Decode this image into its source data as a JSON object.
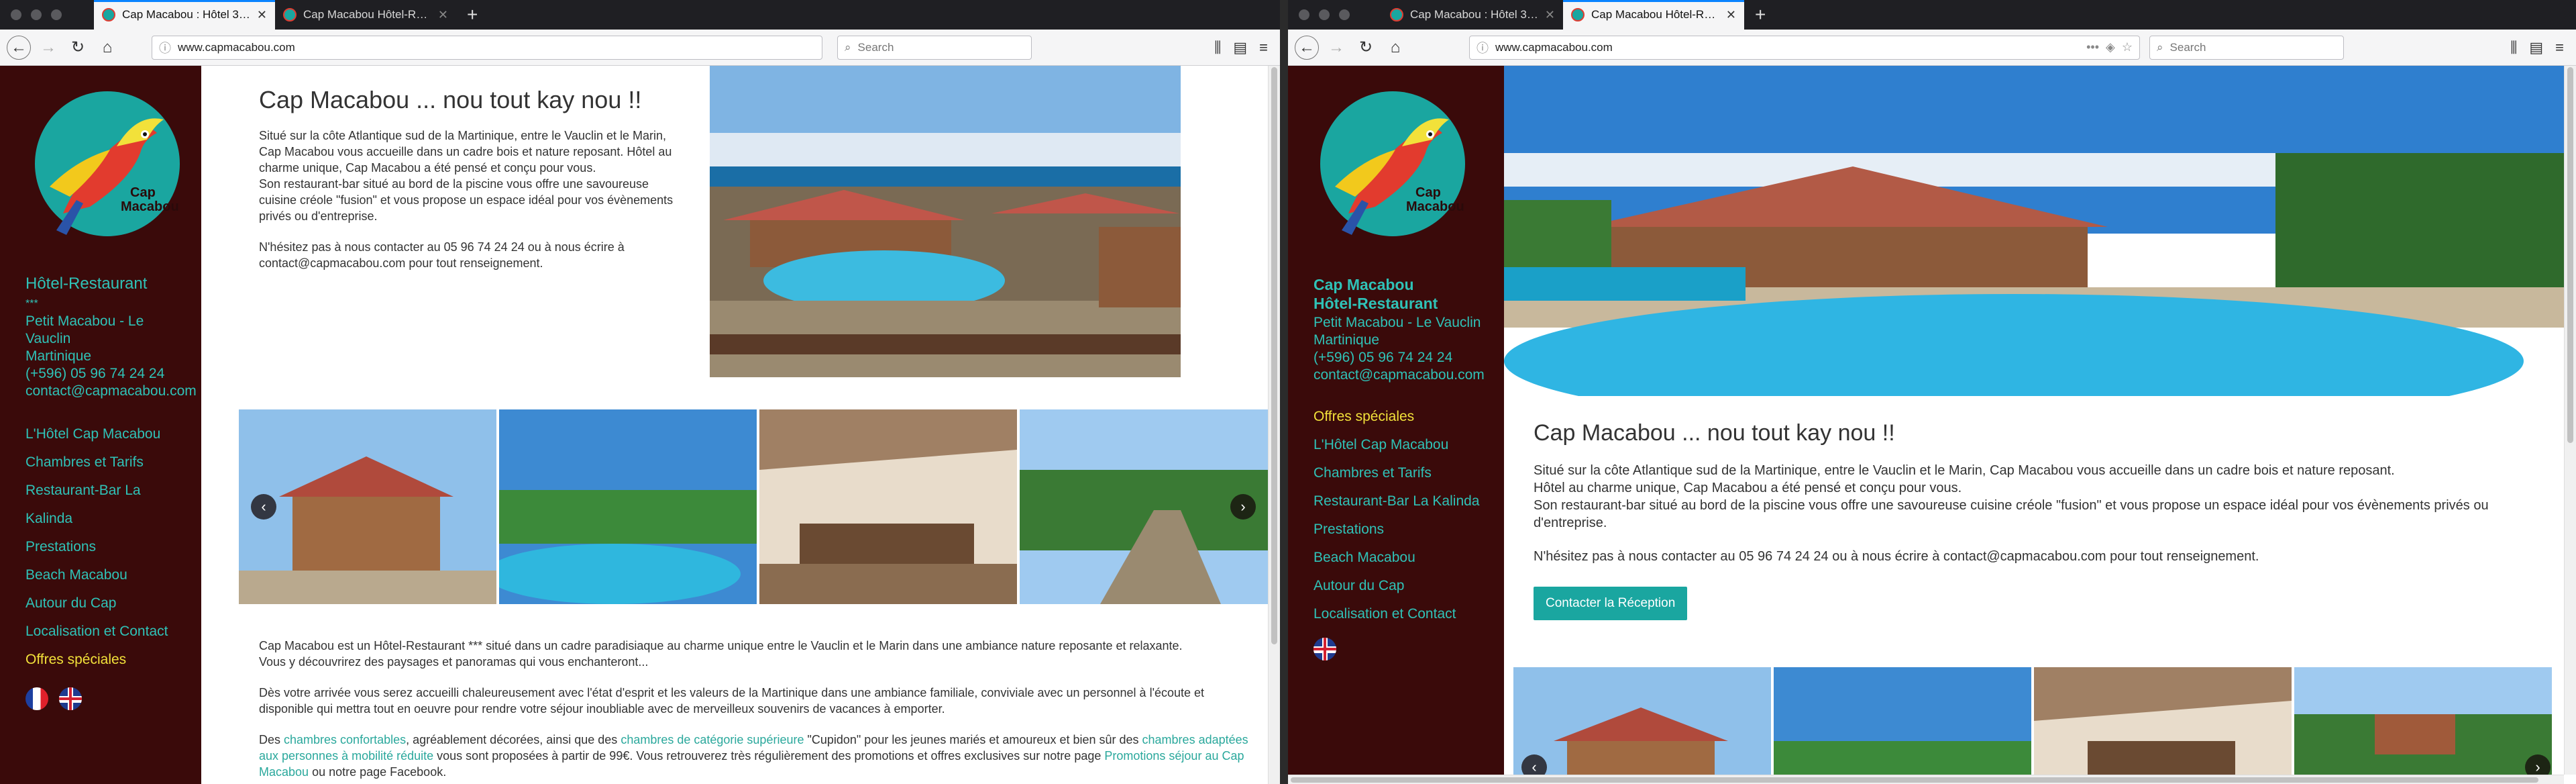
{
  "left": {
    "tabs": [
      {
        "label": "Cap Macabou : Hôtel 3 étoiles e",
        "active": true
      },
      {
        "label": "Cap Macabou Hôtel-Restaurant",
        "active": false
      }
    ],
    "url": "www.capmacabou.com",
    "search_placeholder": "Search",
    "sidebar": {
      "logo_text": [
        "Cap",
        "Macabou"
      ],
      "hotel_type": "Hôtel-Restaurant",
      "stars": "***",
      "address": [
        "Petit Macabou - Le",
        "Vauclin",
        "Martinique"
      ],
      "phone": "(+596) 05 96 74 24 24",
      "email": "contact@capmacabou.com",
      "menu": [
        {
          "label": "L'Hôtel Cap Macabou"
        },
        {
          "label": "Chambres et Tarifs"
        },
        {
          "label": "Restaurant-Bar La"
        },
        {
          "label": "Kalinda"
        },
        {
          "label": "Prestations"
        },
        {
          "label": "Beach Macabou"
        },
        {
          "label": "Autour du Cap"
        },
        {
          "label": "Localisation et Contact"
        },
        {
          "label": "Offres spéciales",
          "highlight": true
        }
      ]
    },
    "heading": "Cap Macabou ... nou tout kay nou !!",
    "intro": [
      "Situé sur la côte Atlantique sud de la Martinique, entre le Vauclin et le Marin,",
      "Cap Macabou vous accueille dans un cadre bois et nature reposant. Hôtel au",
      "charme unique, Cap Macabou a été pensé et conçu pour vous.",
      "Son restaurant-bar situé au bord de la piscine vous offre une savoureuse",
      "cuisine créole \"fusion\" et vous propose un espace idéal pour vos évènements",
      "privés ou d'entreprise."
    ],
    "contact_lines": [
      "N'hésitez pas à nous contacter au 05 96 74 24 24 ou à nous écrire à",
      "contact@capmacabou.com pour tout renseignement."
    ],
    "desc1": [
      "Cap Macabou est un Hôtel-Restaurant *** situé dans un cadre paradisiaque au charme unique entre le Vauclin et le Marin dans une ambiance nature reposante et relaxante.",
      "Vous y découvrirez des paysages et panoramas qui vous enchanteront..."
    ],
    "desc2": [
      "Dès votre arrivée vous serez accueilli chaleureusement avec l'état d'esprit et les valeurs de la Martinique dans une ambiance familiale, conviviale avec un personnel à l'écoute et",
      "disponible qui mettra tout en oeuvre pour rendre votre séjour inoubliable avec de merveilleux souvenirs de vacances à emporter."
    ],
    "desc3": {
      "a": "Des ",
      "l1": "chambres confortables",
      "b": ", agréablement décorées, ainsi que des ",
      "l2": "chambres de catégorie supérieure",
      "c": " \"Cupidon\" pour les jeunes mariés et amoureux et bien sûr des ",
      "l3": "chambres adaptées",
      "l3b": "aux personnes à mobilité réduite",
      "d": " vous sont proposées à partir de 99€. Vous retrouverez très régulièrement des promotions et offres exclusives sur notre page ",
      "l4": "Promotions séjour au Cap",
      "l4b": "Macabou",
      "e": " ou notre page Facebook."
    }
  },
  "right": {
    "tabs": [
      {
        "label": "Cap Macabou : Hôtel 3 étoiles e",
        "active": false
      },
      {
        "label": "Cap Macabou Hôtel-Restaurant",
        "active": true
      }
    ],
    "url": "www.capmacabou.com",
    "search_placeholder": "Search",
    "sidebar": {
      "logo_text": [
        "Cap",
        "Macabou"
      ],
      "name1": "Cap Macabou",
      "name2": "Hôtel-Restaurant",
      "address": [
        "Petit Macabou - Le Vauclin",
        "Martinique"
      ],
      "phone": "(+596) 05 96 74 24 24",
      "email": "contact@capmacabou.com",
      "menu": [
        {
          "label": "Offres spéciales",
          "highlight": true
        },
        {
          "label": "L'Hôtel Cap Macabou"
        },
        {
          "label": "Chambres et Tarifs"
        },
        {
          "label": "Restaurant-Bar La Kalinda"
        },
        {
          "label": "Prestations"
        },
        {
          "label": "Beach Macabou"
        },
        {
          "label": "Autour du Cap"
        },
        {
          "label": "Localisation et Contact"
        }
      ]
    },
    "heading": "Cap Macabou ... nou tout kay nou !!",
    "intro": [
      "Situé sur la côte Atlantique sud de la Martinique, entre le Vauclin et le Marin, Cap Macabou vous accueille dans un cadre bois et nature reposant.",
      "Hôtel au charme unique, Cap Macabou a été pensé et conçu pour vous.",
      "Son restaurant-bar situé au bord de la piscine vous offre une savoureuse cuisine créole \"fusion\" et vous propose un espace idéal pour vos évènements privés ou",
      "d'entreprise."
    ],
    "contact_line": "N'hésitez pas à nous contacter au 05 96 74 24 24 ou à nous écrire à contact@capmacabou.com pour tout renseignement.",
    "contact_button": "Contacter la Réception"
  },
  "icons": {
    "prev": "‹",
    "next": "›"
  }
}
